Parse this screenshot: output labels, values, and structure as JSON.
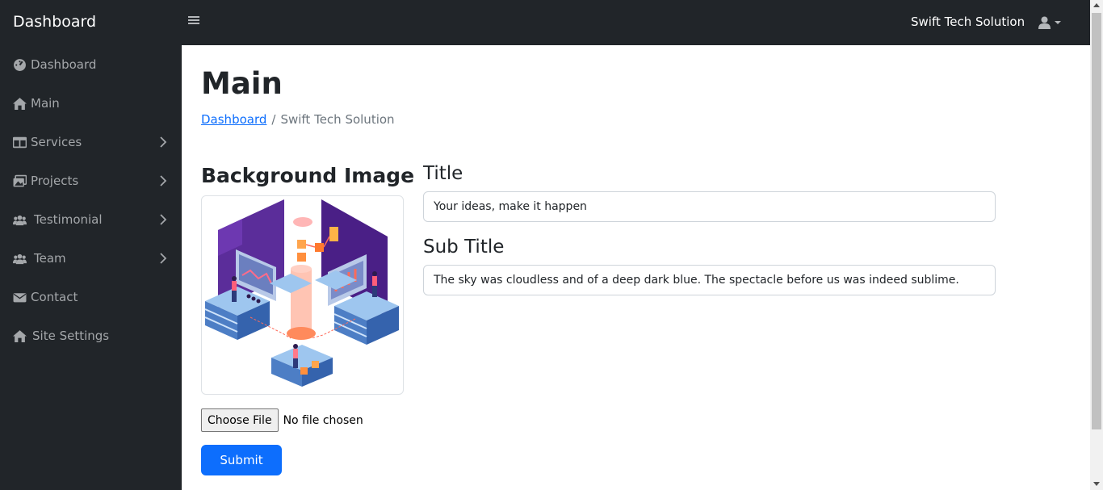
{
  "header": {
    "brand": "Dashboard",
    "company": "Swift Tech Solution",
    "user_icon": "user-icon"
  },
  "sidebar": {
    "items": [
      {
        "label": "Dashboard",
        "icon": "gauge-icon",
        "has_submenu": false
      },
      {
        "label": "Main",
        "icon": "home-icon",
        "has_submenu": false
      },
      {
        "label": "Services",
        "icon": "columns-icon",
        "has_submenu": true
      },
      {
        "label": "Projects",
        "icon": "images-icon",
        "has_submenu": true
      },
      {
        "label": "Testimonial",
        "icon": "users-icon",
        "has_submenu": true
      },
      {
        "label": "Team",
        "icon": "users-icon",
        "has_submenu": true
      },
      {
        "label": "Contact",
        "icon": "envelope-icon",
        "has_submenu": false
      },
      {
        "label": "Site Settings",
        "icon": "home-icon",
        "has_submenu": false
      }
    ]
  },
  "main": {
    "title": "Main",
    "breadcrumb": {
      "link": "Dashboard",
      "separator": "/",
      "current": "Swift Tech Solution"
    },
    "background_image": {
      "heading": "Background Image",
      "choose_file_label": "Choose File",
      "file_status": "No file chosen"
    },
    "title_field": {
      "label": "Title",
      "value": "Your ideas, make it happen"
    },
    "subtitle_field": {
      "label": "Sub Title",
      "value": "The sky was cloudless and of a deep dark blue. The spectacle before us was indeed sublime."
    },
    "submit_label": "Submit"
  },
  "colors": {
    "topbar": "#212529",
    "sidebar": "#212529",
    "primary": "#0d6efd",
    "nav_text": "#a4a7aa",
    "muted": "#6c757d"
  }
}
